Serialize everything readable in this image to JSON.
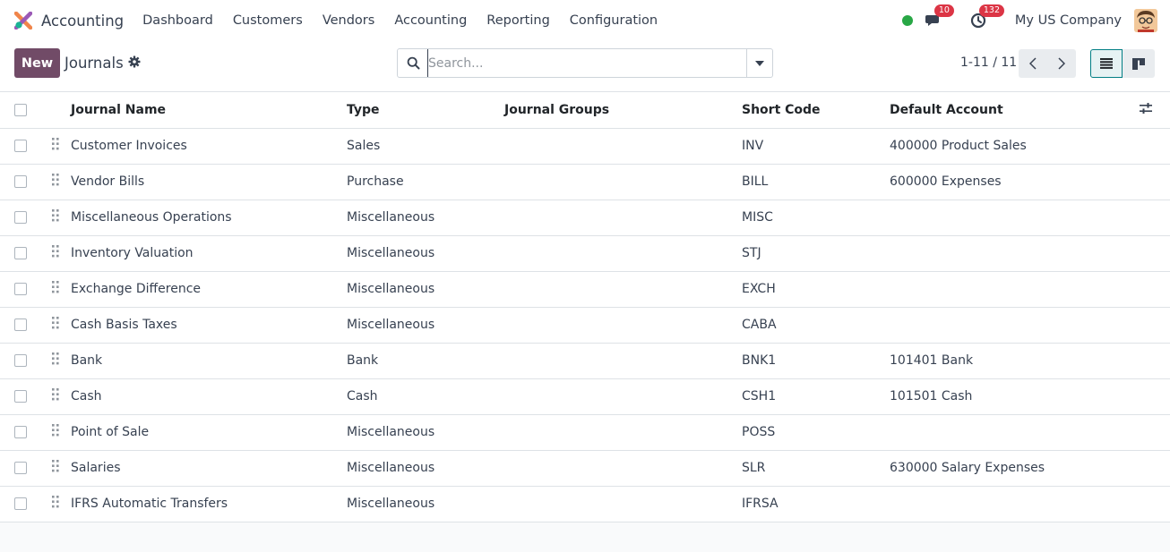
{
  "app": {
    "name": "Accounting",
    "menu": [
      "Dashboard",
      "Customers",
      "Vendors",
      "Accounting",
      "Reporting",
      "Configuration"
    ]
  },
  "systray": {
    "messages_count": "10",
    "activities_count": "132",
    "company": "My US Company"
  },
  "control_panel": {
    "new_label": "New",
    "title": "Journals",
    "search_placeholder": "Search...",
    "pager": "1-11 / 11"
  },
  "table": {
    "columns": [
      "Journal Name",
      "Type",
      "Journal Groups",
      "Short Code",
      "Default Account"
    ],
    "rows": [
      {
        "name": "Customer Invoices",
        "type": "Sales",
        "groups": "",
        "code": "INV",
        "account": "400000 Product Sales"
      },
      {
        "name": "Vendor Bills",
        "type": "Purchase",
        "groups": "",
        "code": "BILL",
        "account": "600000 Expenses"
      },
      {
        "name": "Miscellaneous Operations",
        "type": "Miscellaneous",
        "groups": "",
        "code": "MISC",
        "account": ""
      },
      {
        "name": "Inventory Valuation",
        "type": "Miscellaneous",
        "groups": "",
        "code": "STJ",
        "account": ""
      },
      {
        "name": "Exchange Difference",
        "type": "Miscellaneous",
        "groups": "",
        "code": "EXCH",
        "account": ""
      },
      {
        "name": "Cash Basis Taxes",
        "type": "Miscellaneous",
        "groups": "",
        "code": "CABA",
        "account": ""
      },
      {
        "name": "Bank",
        "type": "Bank",
        "groups": "",
        "code": "BNK1",
        "account": "101401 Bank"
      },
      {
        "name": "Cash",
        "type": "Cash",
        "groups": "",
        "code": "CSH1",
        "account": "101501 Cash"
      },
      {
        "name": "Point of Sale",
        "type": "Miscellaneous",
        "groups": "",
        "code": "POSS",
        "account": ""
      },
      {
        "name": "Salaries",
        "type": "Miscellaneous",
        "groups": "",
        "code": "SLR",
        "account": "630000 Salary Expenses"
      },
      {
        "name": "IFRS Automatic Transfers",
        "type": "Miscellaneous",
        "groups": "",
        "code": "IFRSA",
        "account": ""
      }
    ]
  },
  "colors": {
    "brand": "#714b67",
    "accent": "#017e84",
    "status_online": "#28a745",
    "badge": "#dc3545"
  },
  "icons": [
    "accounting-logo-icon",
    "chat-icon",
    "clock-icon",
    "gear-icon",
    "search-icon",
    "caret-down-icon",
    "chevron-left-icon",
    "chevron-right-icon",
    "list-view-icon",
    "kanban-view-icon",
    "drag-handle-icon",
    "optional-columns-icon"
  ]
}
